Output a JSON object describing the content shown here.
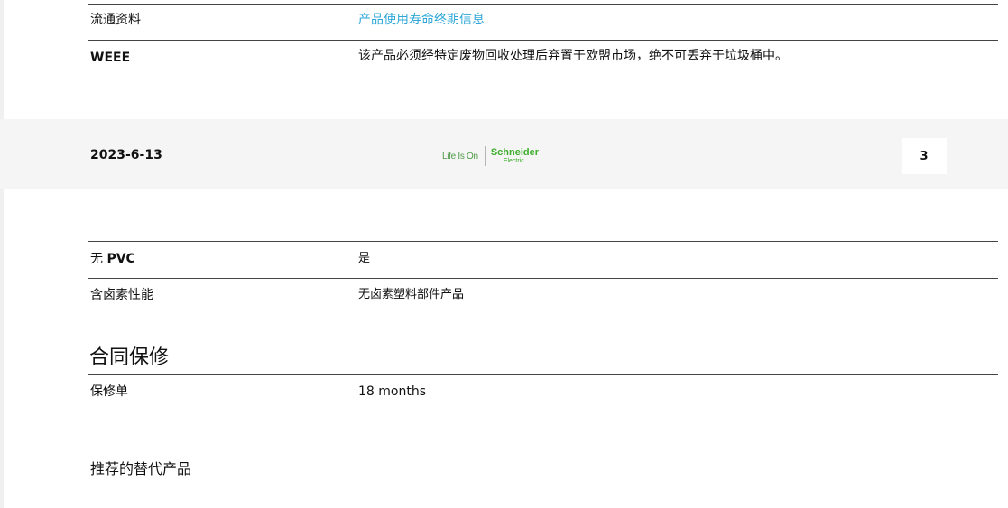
{
  "rows_top": [
    {
      "label": "流通资料",
      "value": "产品使用寿命终期信息"
    },
    {
      "label": "WEEE",
      "value": "该产品必须经特定废物回收处理后弃置于欧盟市场，绝不可丢弃于垃圾桶中。"
    }
  ],
  "footer": {
    "date": "2023-6-13",
    "logo_tagline": "Life Is On",
    "logo_brand": "Schneider",
    "logo_sub": "Electric",
    "page_number": "3"
  },
  "rows_env": [
    {
      "label": "无 PVC",
      "value": "是"
    },
    {
      "label": "含卤素性能",
      "value": "无卤素塑料部件产品"
    }
  ],
  "warranty": {
    "title": "合同保修",
    "label": "保修单",
    "value": "18 months"
  },
  "alternatives": {
    "title": "推荐的替代产品"
  },
  "colors": {
    "link": "#2ea7d8",
    "brand_green": "#3dae2b"
  }
}
